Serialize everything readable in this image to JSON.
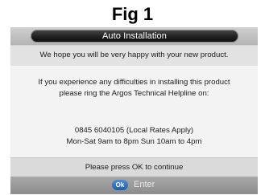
{
  "figure_label": "Fig 1",
  "dialog": {
    "title": "Auto Installation",
    "welcome": "We hope you will be very happy with your new product.",
    "help_line_1": "If you experience any difficulties in installing this product",
    "help_line_2": "please ring the Argos Technical Helpline on:",
    "phone": "0845 6040105 (Local Rates Apply)",
    "hours": "Mon-Sat 9am to 8pm Sun 10am to 4pm",
    "prompt": "Please press OK to continue"
  },
  "footer": {
    "ok_key": "Ok",
    "enter_label": "Enter"
  },
  "colors": {
    "title_pill": "#1a1a1a",
    "screen_background": "#ececec",
    "ok_badge": "#2f6fbe"
  },
  "icons": {
    "ok_button": "ok-remote-key-icon"
  }
}
